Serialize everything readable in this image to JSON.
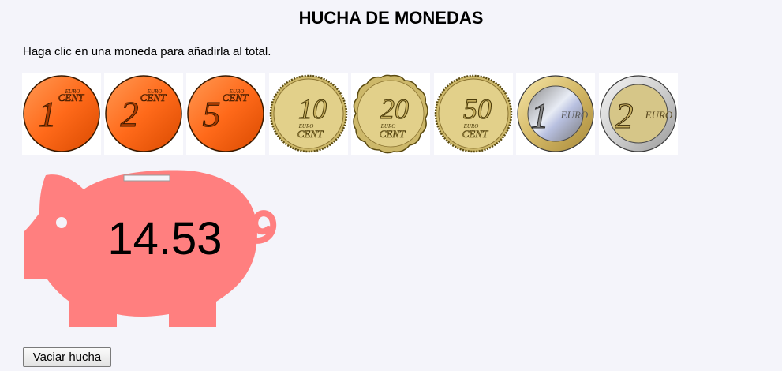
{
  "header": {
    "title": "HUCHA DE MONEDAS"
  },
  "instructions": "Haga clic en una moneda para añadirla al total.",
  "coins": [
    {
      "numeral": "1",
      "unit_top": "EURO",
      "unit_bottom": "CENT",
      "type": "copper"
    },
    {
      "numeral": "2",
      "unit_top": "EURO",
      "unit_bottom": "CENT",
      "type": "copper"
    },
    {
      "numeral": "5",
      "unit_top": "EURO",
      "unit_bottom": "CENT",
      "type": "copper"
    },
    {
      "numeral": "10",
      "unit_top": "EURO",
      "unit_bottom": "CENT",
      "type": "gold"
    },
    {
      "numeral": "20",
      "unit_top": "EURO",
      "unit_bottom": "CENT",
      "type": "gold-scalloped"
    },
    {
      "numeral": "50",
      "unit_top": "EURO",
      "unit_bottom": "CENT",
      "type": "gold"
    },
    {
      "numeral": "1",
      "unit_label": "EURO",
      "type": "bimetal-silver-center"
    },
    {
      "numeral": "2",
      "unit_label": "EURO",
      "type": "bimetal-gold-center"
    }
  ],
  "piggy_bank": {
    "total": "14.53",
    "color": "#ff7f7f"
  },
  "controls": {
    "empty_button_label": "Vaciar hucha"
  }
}
